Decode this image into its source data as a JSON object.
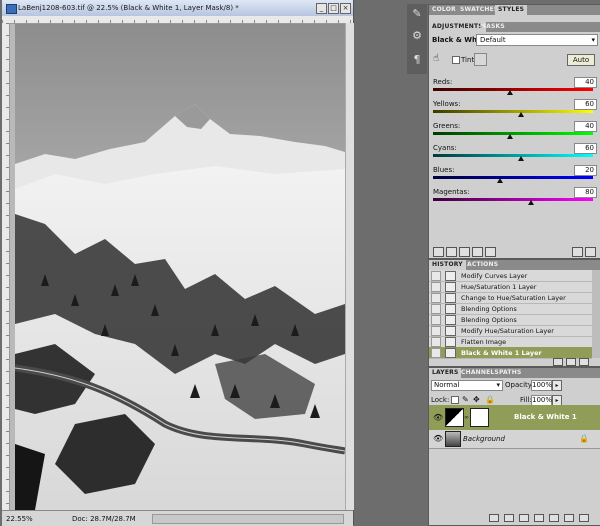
{
  "document": {
    "title": "LaBenj1208-603.tif @ 22.5% (Black & White 1, Layer Mask/8) *",
    "zoom": "22.55%",
    "doc_size": "Doc: 28.7M/28.7M"
  },
  "adjustments": {
    "tabs": [
      "ADJUSTMENTS",
      "MASKS"
    ],
    "top_tabs": [
      "COLOR",
      "SWATCHES",
      "STYLES"
    ],
    "adjustment_name": "Black & White",
    "preset": "Default",
    "tint_label": "Tint",
    "auto_label": "Auto",
    "sliders": [
      {
        "label": "Reds:",
        "value": "40",
        "frac": 0.48,
        "gradient": "linear-gradient(90deg,#3a0000,#ff0000)"
      },
      {
        "label": "Yellows:",
        "value": "60",
        "frac": 0.55,
        "gradient": "linear-gradient(90deg,#3a3a00,#ffff00)"
      },
      {
        "label": "Greens:",
        "value": "40",
        "frac": 0.48,
        "gradient": "linear-gradient(90deg,#003a00,#00ff00)"
      },
      {
        "label": "Cyans:",
        "value": "60",
        "frac": 0.55,
        "gradient": "linear-gradient(90deg,#003a3a,#00ffff)"
      },
      {
        "label": "Blues:",
        "value": "20",
        "frac": 0.42,
        "gradient": "linear-gradient(90deg,#00003a,#0000ff)"
      },
      {
        "label": "Magentas:",
        "value": "80",
        "frac": 0.61,
        "gradient": "linear-gradient(90deg,#3a003a,#ff00ff)"
      }
    ]
  },
  "history": {
    "tabs": [
      "HISTORY",
      "ACTIONS"
    ],
    "items": [
      {
        "label": "Modify Curves Layer",
        "selected": false
      },
      {
        "label": "Hue/Saturation 1 Layer",
        "selected": false
      },
      {
        "label": "Change to Hue/Saturation Layer",
        "selected": false
      },
      {
        "label": "Blending Options",
        "selected": false
      },
      {
        "label": "Blending Options",
        "selected": false
      },
      {
        "label": "Modify Hue/Saturation Layer",
        "selected": false
      },
      {
        "label": "Flatten Image",
        "selected": false
      },
      {
        "label": "Black & White 1 Layer",
        "selected": true
      }
    ]
  },
  "layers": {
    "tabs": [
      "LAYERS",
      "CHANNELS",
      "PATHS"
    ],
    "blend_mode": "Normal",
    "opacity_label": "Opacity:",
    "opacity": "100%",
    "lock_label": "Lock:",
    "fill_label": "Fill:",
    "fill": "100%",
    "items": [
      {
        "name": "Black & White 1",
        "selected": true
      },
      {
        "name": "Background",
        "selected": false
      }
    ]
  },
  "colors": {
    "accent": "#8f9d59",
    "panel": "#cfcfcf",
    "workspace": "#6d6d6d"
  }
}
